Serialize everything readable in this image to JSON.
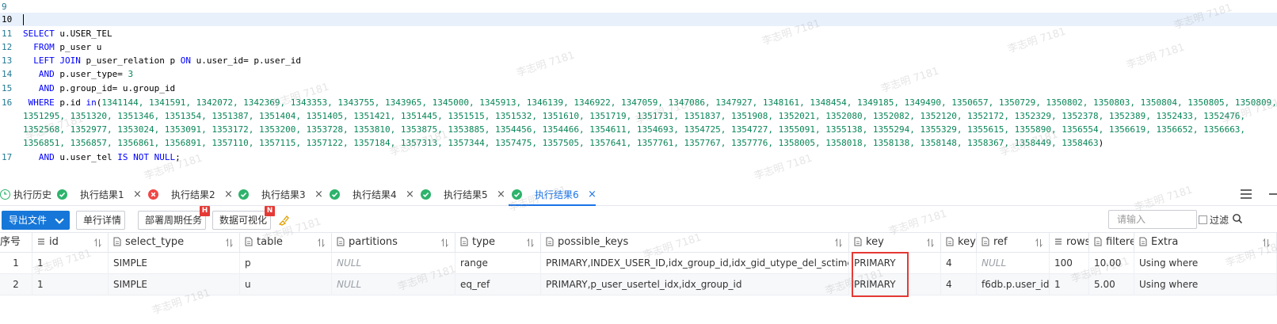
{
  "editor": {
    "lines": [
      {
        "n": "9",
        "parts": []
      },
      {
        "n": "10",
        "parts": [],
        "active": true
      },
      {
        "n": "11",
        "parts": [
          {
            "t": "kw",
            "v": "SELECT"
          },
          {
            "t": "id",
            "v": " u.USER_TEL"
          }
        ]
      },
      {
        "n": "12",
        "parts": [
          {
            "t": "id",
            "v": "  "
          },
          {
            "t": "kw",
            "v": "FROM"
          },
          {
            "t": "id",
            "v": " p_user u"
          }
        ]
      },
      {
        "n": "13",
        "parts": [
          {
            "t": "id",
            "v": "  "
          },
          {
            "t": "kw",
            "v": "LEFT JOIN"
          },
          {
            "t": "id",
            "v": " p_user_relation p "
          },
          {
            "t": "kw",
            "v": "ON"
          },
          {
            "t": "id",
            "v": " u.user_id= p.user_id"
          }
        ]
      },
      {
        "n": "14",
        "parts": [
          {
            "t": "id",
            "v": "   "
          },
          {
            "t": "kw",
            "v": "AND"
          },
          {
            "t": "id",
            "v": " p.user_type= "
          },
          {
            "t": "num",
            "v": "3"
          }
        ]
      },
      {
        "n": "15",
        "parts": [
          {
            "t": "id",
            "v": "   "
          },
          {
            "t": "kw",
            "v": "AND"
          },
          {
            "t": "id",
            "v": " p.group_id= u.group_id"
          }
        ]
      },
      {
        "n": "16",
        "parts": [
          {
            "t": "id",
            "v": " "
          },
          {
            "t": "kw",
            "v": "WHERE"
          },
          {
            "t": "id",
            "v": " p.id "
          },
          {
            "t": "kw",
            "v": "in"
          },
          {
            "t": "id",
            "v": "("
          },
          {
            "t": "num",
            "v": "1341144, 1341591, 1342072, 1342369, 1343353, 1343755, 1343965, 1345000, 1345913, 1346139, 1346922, 1347059, 1347086, 1347927, 1348161, 1348454, 1349185, 1349490, 1350657, 1350729, 1350802, 1350803, 1350804, 1350805, 1350809,"
          }
        ]
      },
      {
        "n": "",
        "parts": [
          {
            "t": "num",
            "v": "1351295, 1351320, 1351346, 1351354, 1351387, 1351404, 1351405, 1351421, 1351445, 1351515, 1351532, 1351610, 1351719, 1351731, 1351837, 1351908, 1352021, 1352080, 1352082, 1352120, 1352172, 1352329, 1352378, 1352389, 1352433, 1352476,"
          }
        ]
      },
      {
        "n": "",
        "parts": [
          {
            "t": "num",
            "v": "1352568, 1352977, 1353024, 1353091, 1353172, 1353200, 1353728, 1353810, 1353875, 1353885, 1354456, 1354466, 1354611, 1354693, 1354725, 1354727, 1355091, 1355138, 1355294, 1355329, 1355615, 1355890, 1356554, 1356619, 1356652, 1356663,"
          }
        ]
      },
      {
        "n": "",
        "parts": [
          {
            "t": "num",
            "v": "1356851, 1356857, 1356861, 1356891, 1357110, 1357115, 1357122, 1357184, 1357313, 1357344, 1357475, 1357505, 1357641, 1357761, 1357767, 1357776, 1358005, 1358018, 1358138, 1358148, 1358367, 1358449, 1358463"
          },
          {
            "t": "id",
            "v": ")"
          }
        ]
      },
      {
        "n": "17",
        "parts": [
          {
            "t": "id",
            "v": "   "
          },
          {
            "t": "kw",
            "v": "AND"
          },
          {
            "t": "id",
            "v": " u.user_tel "
          },
          {
            "t": "kw",
            "v": "IS NOT NULL"
          },
          {
            "t": "id",
            "v": ";"
          }
        ]
      }
    ]
  },
  "tabs": {
    "history": "执行历史",
    "results": [
      {
        "label": "执行结果1",
        "status": "ok",
        "active": false
      },
      {
        "label": "执行结果2",
        "status": "err",
        "active": false
      },
      {
        "label": "执行结果3",
        "status": "ok",
        "active": false
      },
      {
        "label": "执行结果4",
        "status": "ok",
        "active": false
      },
      {
        "label": "执行结果5",
        "status": "ok",
        "active": false
      },
      {
        "label": "执行结果6",
        "status": "ok",
        "active": true
      }
    ],
    "close_glyph": "×"
  },
  "toolbar": {
    "export_label": "导出文件",
    "row_detail_label": "单行详情",
    "deploy_label": "部署周期任务",
    "deploy_badge": "H",
    "visualize_label": "数据可视化",
    "visualize_badge": "N",
    "search_placeholder": "请输入",
    "filter_label": "过滤"
  },
  "grid": {
    "columns": [
      {
        "label": "序号",
        "icon": false,
        "sort": false
      },
      {
        "label": "id",
        "icon": true,
        "sort": true
      },
      {
        "label": "select_type",
        "icon": true,
        "sort": true
      },
      {
        "label": "table",
        "icon": true,
        "sort": true
      },
      {
        "label": "partitions",
        "icon": true,
        "sort": true
      },
      {
        "label": "type",
        "icon": true,
        "sort": true
      },
      {
        "label": "possible_keys",
        "icon": true,
        "sort": true
      },
      {
        "label": "key",
        "icon": true,
        "sort": true
      },
      {
        "label": "key",
        "icon": true,
        "sort": false
      },
      {
        "label": "ref",
        "icon": true,
        "sort": true
      },
      {
        "label": "rows",
        "icon": true,
        "sort": false
      },
      {
        "label": "filtere",
        "icon": true,
        "sort": false
      },
      {
        "label": "Extra",
        "icon": true,
        "sort": true
      }
    ],
    "rows": [
      [
        "1",
        "1",
        "SIMPLE",
        "p",
        "NULL",
        "range",
        "PRIMARY,INDEX_USER_ID,idx_group_id,idx_gid_utype_del_sctime",
        "PRIMARY",
        "4",
        "NULL",
        "100",
        "10.00",
        "Using where"
      ],
      [
        "2",
        "1",
        "SIMPLE",
        "u",
        "NULL",
        "eq_ref",
        "PRIMARY,p_user_usertel_idx,idx_group_id",
        "PRIMARY",
        "4",
        "f6db.p.user_id",
        "1",
        "5.00",
        "Using where"
      ]
    ]
  },
  "watermark": "李志明 7181",
  "colors": {
    "accent": "#1a73e8",
    "ok": "#2db36b",
    "err": "#f04646",
    "highlight": "#e53935"
  }
}
